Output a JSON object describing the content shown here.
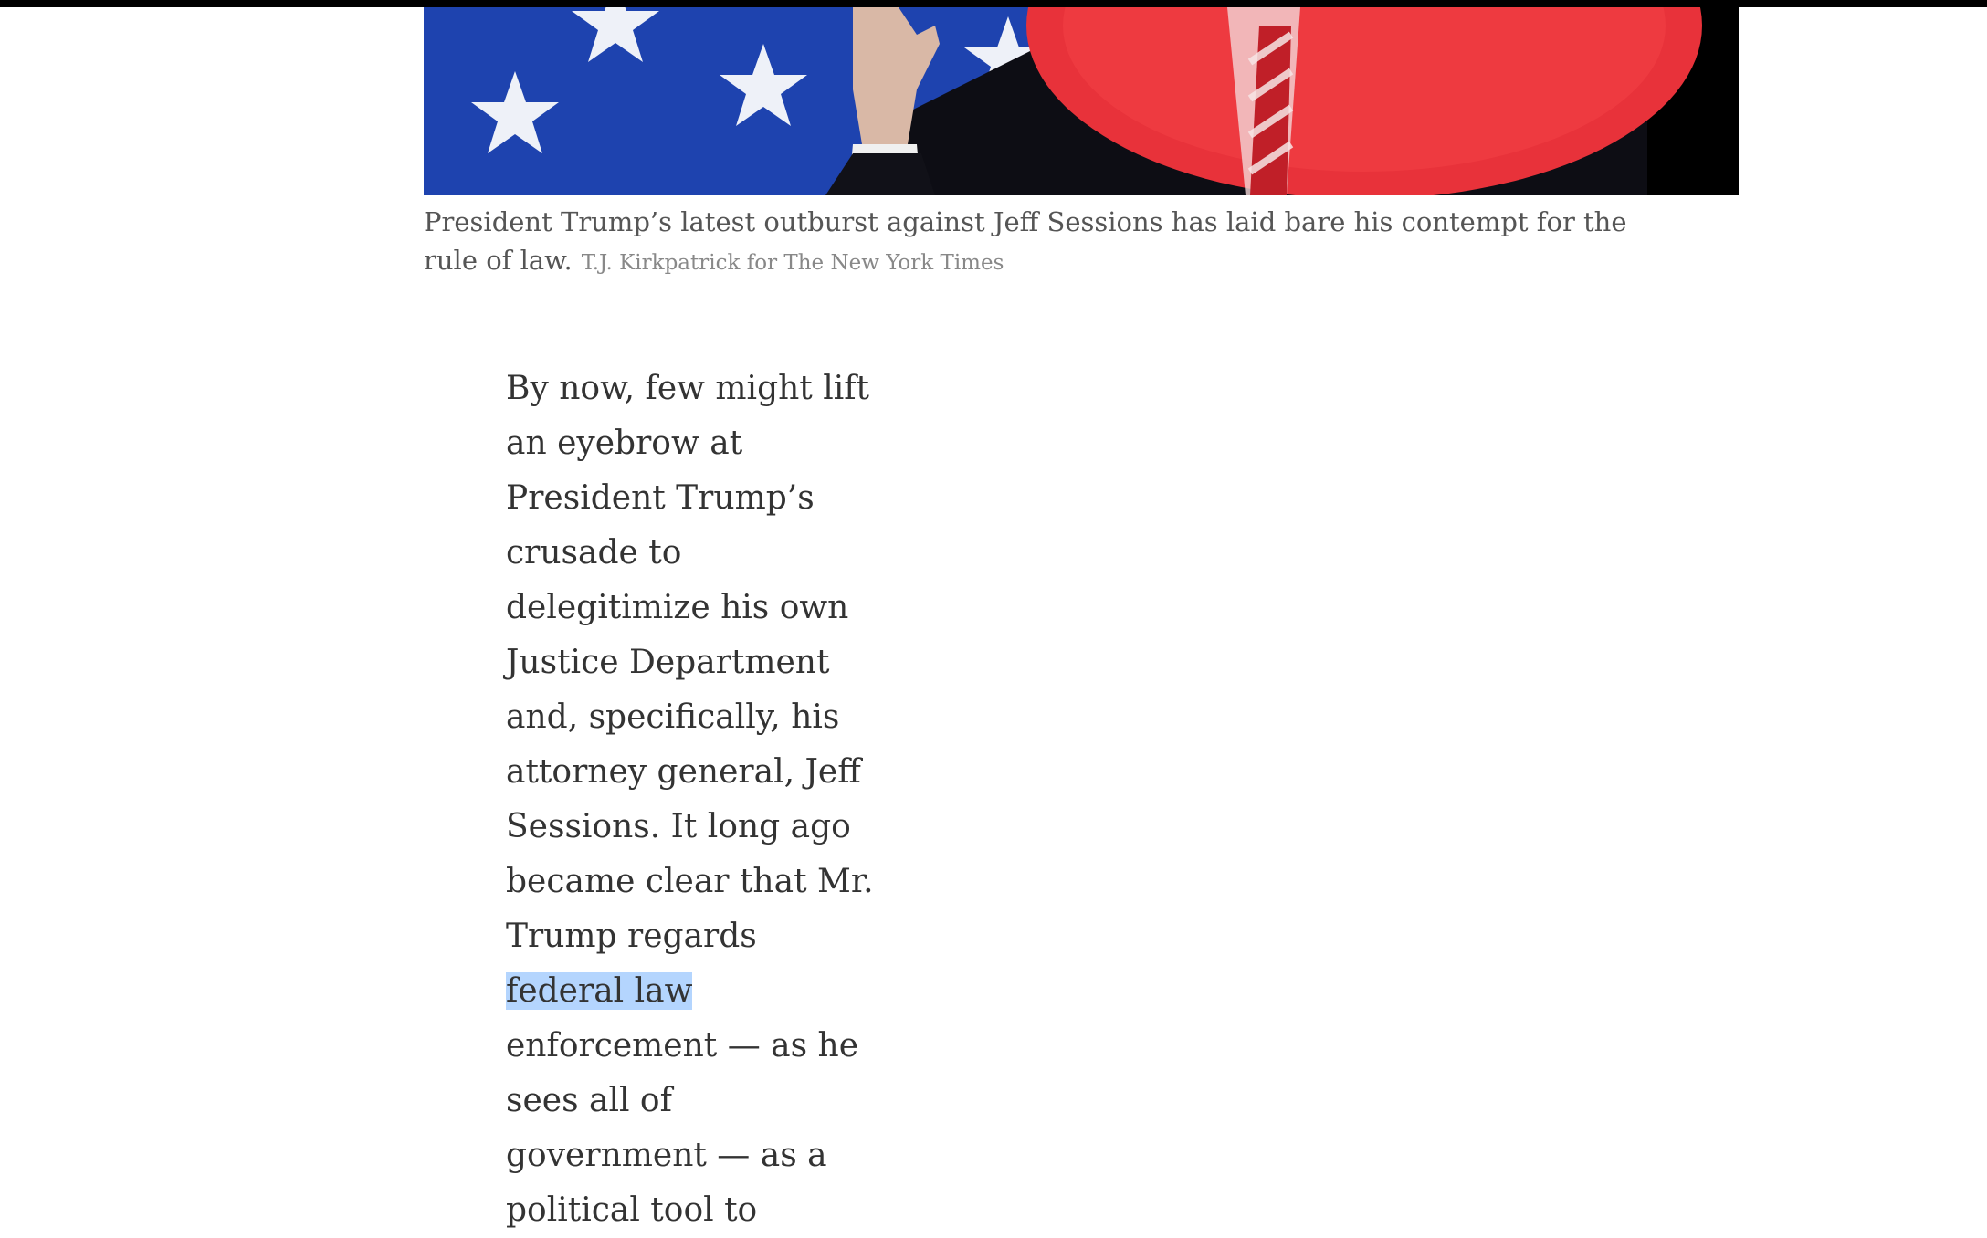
{
  "photo": {
    "caption": "President Trump’s latest outburst against Jeff Sessions has laid bare his contempt for the rule of law.",
    "credit": "T.J. Kirkpatrick for The New York Times",
    "colors": {
      "flag_blue": "#1a3c9e",
      "star_white": "#e8ecf6",
      "spotlight_red": "#e8323a",
      "background_black": "#000000"
    }
  },
  "article": {
    "lines": [
      "By now, few might lift",
      "an eyebrow at",
      "President Trump’s",
      "crusade to",
      "delegitimize his own",
      "Justice Department",
      "and, specifically, his",
      "attorney general, Jeff",
      "Sessions. It long ago",
      "became clear that Mr.",
      "Trump regards"
    ],
    "highlighted": "federal law",
    "lines_after": [
      "enforcement — as he",
      "sees all of",
      "government — as a",
      "political tool to"
    ],
    "highlight_color": "#b4d5fe"
  }
}
